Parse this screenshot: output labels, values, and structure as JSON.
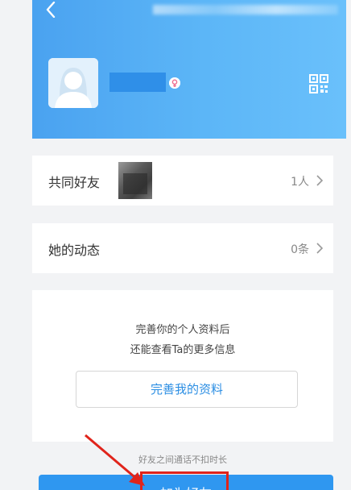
{
  "header": {
    "back_icon": "chevron-left-icon",
    "qr_icon": "qr-code-icon",
    "gender_icon": "female-icon",
    "gradient_color": "#5cb6f7"
  },
  "rows": [
    {
      "label": "共同好友",
      "value": "1人"
    },
    {
      "label": "她的动态",
      "value": "0条"
    }
  ],
  "info": {
    "line1": "完善你的个人资料后",
    "line2": "还能查看Ta的更多信息",
    "complete_button": "完善我的资料"
  },
  "notice": "好友之间通话不扣时长",
  "add_friend_button": "加为好友",
  "colors": {
    "accent_blue": "#2b8ee3",
    "annotation_red": "#e0241b"
  }
}
